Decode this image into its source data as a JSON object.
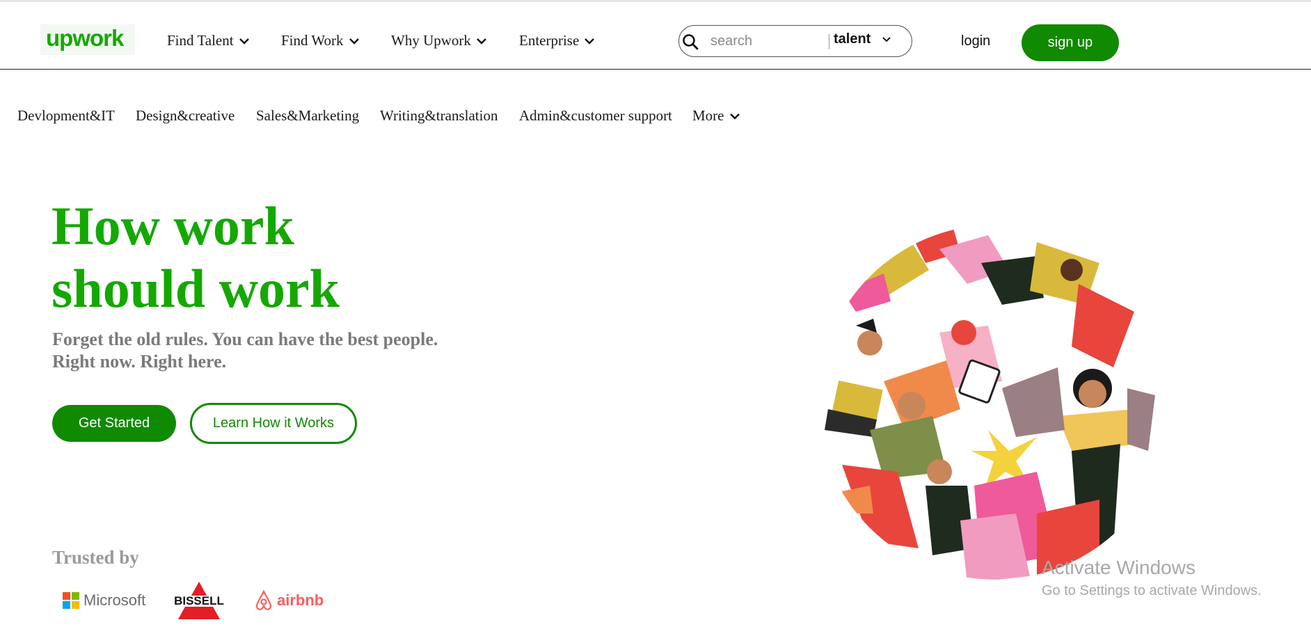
{
  "brand": {
    "logo_text": "upwork",
    "accent": "#14a800",
    "button_green": "#108a00"
  },
  "header": {
    "nav": [
      {
        "label": "Find Talent",
        "icon": "chevron-down-icon"
      },
      {
        "label": "Find Work",
        "icon": "chevron-down-icon"
      },
      {
        "label": "Why Upwork",
        "icon": "chevron-down-icon"
      },
      {
        "label": "Enterprise",
        "icon": "chevron-down-icon"
      }
    ],
    "search": {
      "placeholder": "search",
      "value": "",
      "scope_selected": "talent",
      "icon": "search-icon"
    },
    "login_label": "login",
    "signup_label": "sign up"
  },
  "categories": [
    {
      "label": "Devlopment&IT"
    },
    {
      "label": "Design&creative"
    },
    {
      "label": "Sales&Marketing"
    },
    {
      "label": "Writing&translation"
    },
    {
      "label": "Admin&customer support"
    },
    {
      "label": "More",
      "icon": "chevron-down-icon"
    }
  ],
  "hero": {
    "title_line1": "How work",
    "title_line2": "should work",
    "subtitle_line1": "Forget the old rules. You can have the best people.",
    "subtitle_line2": "Right now. Right here.",
    "primary_cta": "Get Started",
    "secondary_cta": "Learn How it Works"
  },
  "trusted": {
    "heading": "Trusted by",
    "logos": [
      {
        "name": "Microsoft",
        "text": "Microsoft"
      },
      {
        "name": "Bissell",
        "text": "BISSELL"
      },
      {
        "name": "Airbnb",
        "text": "airbnb"
      }
    ]
  },
  "os_watermark": {
    "line1": "Activate Windows",
    "line2": "Go to Settings to activate Windows."
  }
}
